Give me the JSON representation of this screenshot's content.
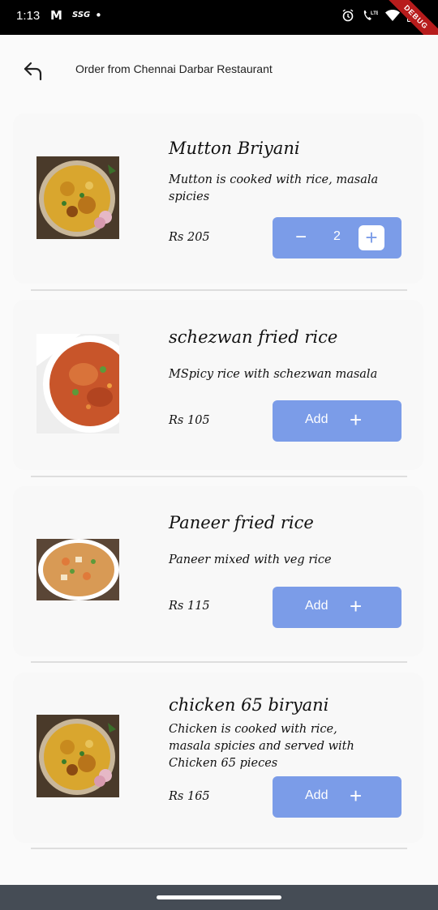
{
  "status_bar": {
    "time": "1:13",
    "gmail_icon": "M",
    "ssg_label": "SSG",
    "dot": "•",
    "debug_label": "DEBUG",
    "icons": [
      "alarm-icon",
      "wifi-calling-lte-icon",
      "wifi-icon",
      "battery-icon"
    ]
  },
  "app_bar": {
    "title": "Order from Chennai Darbar Restaurant",
    "back_icon": "back-arrow-icon"
  },
  "items": [
    {
      "name": "Mutton Briyani",
      "description": "Mutton is cooked with rice, masala spicies",
      "price": "Rs  205",
      "quantity": "2",
      "image": "biryani-image"
    },
    {
      "name": "schezwan fried rice",
      "description": "MSpicy rice with schezwan masala",
      "price": "Rs  105",
      "add_label": "Add",
      "image": "fried-rice-image"
    },
    {
      "name": "Paneer fried rice",
      "description": "Paneer mixed with veg rice",
      "price": "Rs  115",
      "add_label": "Add",
      "image": "paneer-rice-image"
    },
    {
      "name": "chicken 65 biryani",
      "description": "Chicken is cooked with rice, masala spicies and served with Chicken 65 pieces",
      "price": "Rs  165",
      "add_label": "Add",
      "image": "biryani-image"
    }
  ],
  "colors": {
    "accent": "#7b9ce8",
    "status_bar": "#000000",
    "nav_bar": "#454c55",
    "background": "#fafafa"
  }
}
